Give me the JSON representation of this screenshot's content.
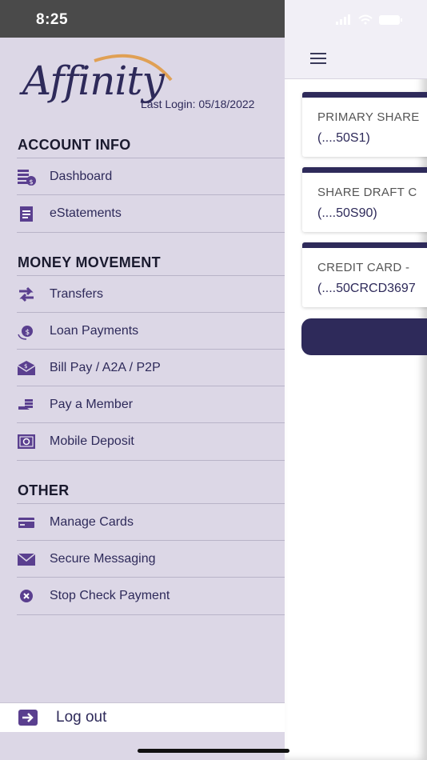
{
  "status_bar": {
    "time": "8:25"
  },
  "brand": {
    "logo_text": "Affinity"
  },
  "last_login": {
    "text": "Last Login:  05/18/2022"
  },
  "sections": {
    "account_info": {
      "title": "ACCOUNT INFO",
      "items": [
        {
          "label": "Dashboard",
          "icon": "dashboard-icon"
        },
        {
          "label": "eStatements",
          "icon": "statement-icon"
        }
      ]
    },
    "money_movement": {
      "title": "MONEY MOVEMENT",
      "items": [
        {
          "label": "Transfers",
          "icon": "transfer-icon"
        },
        {
          "label": "Loan Payments",
          "icon": "loan-icon"
        },
        {
          "label": "Bill Pay / A2A / P2P",
          "icon": "bill-pay-icon"
        },
        {
          "label": "Pay a Member",
          "icon": "pay-member-icon"
        },
        {
          "label": "Mobile Deposit",
          "icon": "mobile-deposit-icon"
        }
      ]
    },
    "other": {
      "title": "OTHER",
      "items": [
        {
          "label": "Manage Cards",
          "icon": "card-icon"
        },
        {
          "label": "Secure Messaging",
          "icon": "mail-icon"
        },
        {
          "label": "Stop Check Payment",
          "icon": "stop-icon"
        }
      ]
    }
  },
  "logout": {
    "label": "Log out",
    "icon": "logout-icon"
  },
  "accounts": [
    {
      "name": "PRIMARY SHARE",
      "number": "(....50S1)"
    },
    {
      "name": "SHARE DRAFT C",
      "number": "(....50S90)"
    },
    {
      "name": "CREDIT CARD -",
      "number": "(....50CRCD3697"
    }
  ],
  "colors": {
    "brand_dark": "#2e2a5a",
    "drawer_bg": "#dcd7e6",
    "logo_swoosh": "#e0a054",
    "icon_purple": "#5a3f8f"
  }
}
